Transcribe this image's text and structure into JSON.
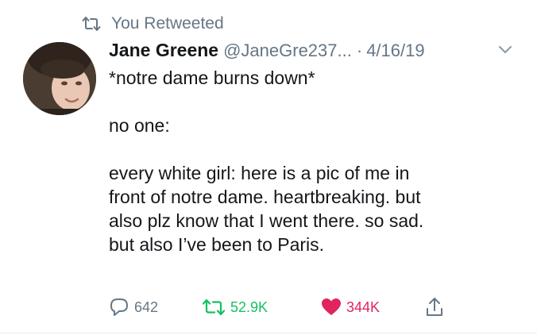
{
  "retweet_context": {
    "label": "You Retweeted",
    "icon": "retweet-icon"
  },
  "author": {
    "display_name": "Jane Greene",
    "handle": "@JaneGre237...",
    "separator": "·",
    "date": "4/16/19"
  },
  "tweet": {
    "text": "*notre dame burns down*\n\nno one:\n\nevery white girl: here is a pic of me in\nfront of notre dame. heartbreaking. but\nalso plz know that I went there. so sad.\nbut also I’ve been to Paris."
  },
  "actions": {
    "reply": {
      "icon": "reply-icon",
      "count": "642"
    },
    "retweet": {
      "icon": "retweet-icon",
      "count": "52.9K",
      "active": true
    },
    "like": {
      "icon": "heart-icon",
      "count": "344K",
      "active": true
    },
    "share": {
      "icon": "share-icon"
    }
  },
  "colors": {
    "secondary_text": "#657786",
    "primary_text": "#14171a",
    "retweet_active": "#17bf63",
    "like_active": "#e0245e"
  }
}
